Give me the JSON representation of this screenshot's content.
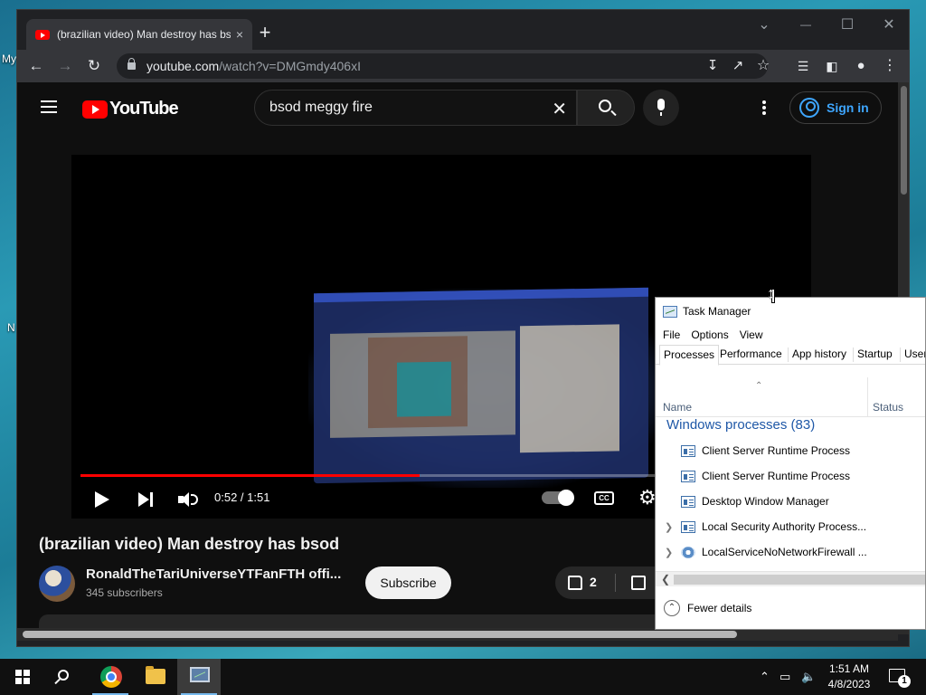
{
  "desktop": {
    "labels": [
      "My",
      "N"
    ]
  },
  "browser": {
    "tab_title": "(brazilian video) Man destroy has bsod",
    "tab_close": "×",
    "new_tab": "+",
    "win_minimize": "—",
    "win_maximize": "☐",
    "win_close": "✕",
    "win_tabsearch": "⌄",
    "url_host": "youtube.com",
    "url_path": "/watch?v=DMGmdy406xI"
  },
  "youtube": {
    "logo_text": "YouTube",
    "search_value": "bsod meggy fire",
    "signin_label": "Sign in",
    "player": {
      "time": "0:52 / 1:51",
      "progress_fraction": 0.47,
      "cc_label": "CC"
    },
    "video_title": "(brazilian video) Man destroy has bsod",
    "channel_name": "RonaldTheTariUniverseYTFanFTH offi...",
    "subscribers": "345 subscribers",
    "subscribe_label": "Subscribe",
    "like_count": "2"
  },
  "task_manager": {
    "title": "Task Manager",
    "menu": [
      "File",
      "Options",
      "View"
    ],
    "tabs": [
      "Processes",
      "Performance",
      "App history",
      "Startup",
      "Users"
    ],
    "columns": {
      "name": "Name",
      "status": "Status"
    },
    "group": "Windows processes (83)",
    "processes": [
      {
        "name": "Client Server Runtime Process",
        "expandable": false
      },
      {
        "name": "Client Server Runtime Process",
        "expandable": false
      },
      {
        "name": "Desktop Window Manager",
        "expandable": false
      },
      {
        "name": "Local Security Authority Process...",
        "expandable": true
      },
      {
        "name": "LocalServiceNoNetworkFirewall ...",
        "expandable": true
      }
    ],
    "fewer_details": "Fewer details"
  },
  "taskbar": {
    "time": "1:51 AM",
    "date": "4/8/2023",
    "notification_count": "1",
    "icons": [
      "start-icon",
      "search-icon",
      "chrome-icon",
      "file-explorer-icon",
      "task-manager-icon"
    ]
  }
}
